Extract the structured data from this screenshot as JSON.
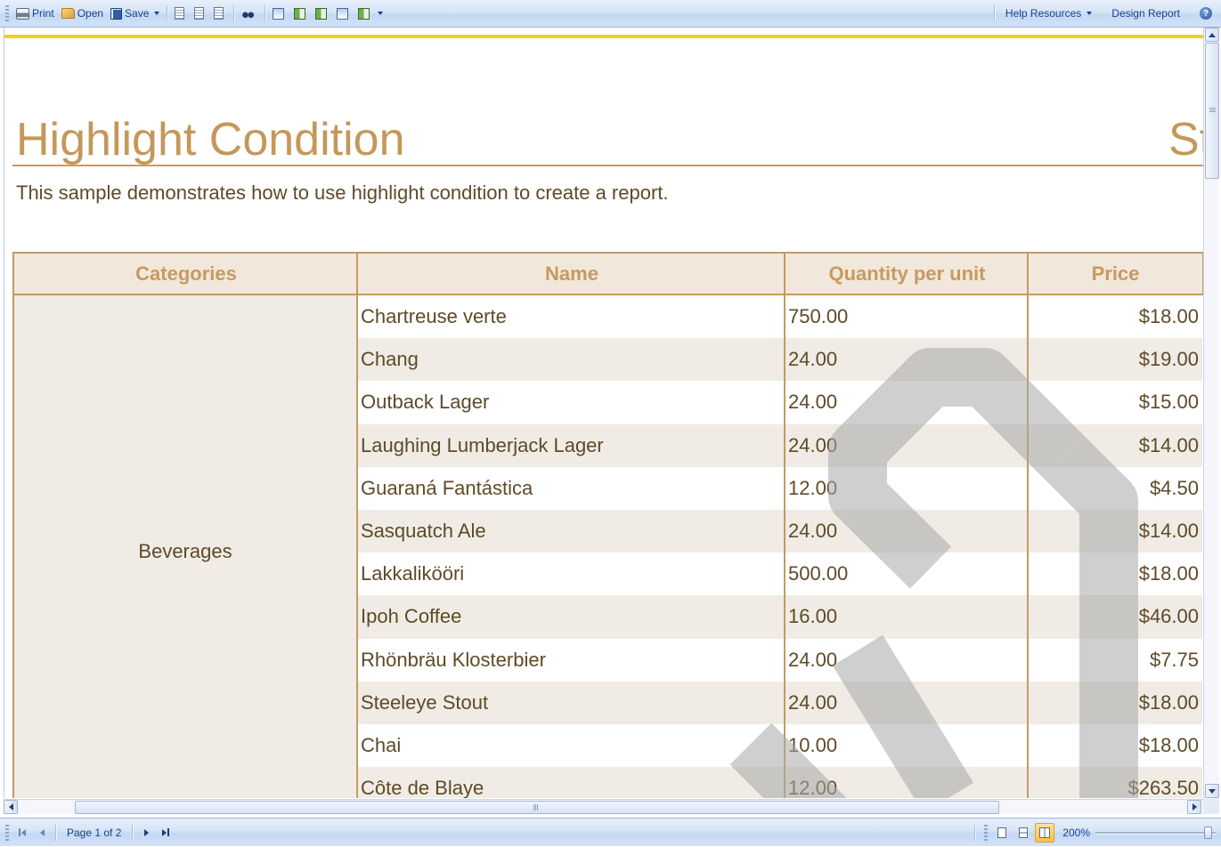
{
  "toolbar": {
    "print_label": "Print",
    "open_label": "Open",
    "save_label": "Save",
    "help_resources_label": "Help Resources",
    "design_report_label": "Design Report",
    "help_icon_glyph": "?"
  },
  "report": {
    "title": "Highlight Condition",
    "title_right_partial": "St",
    "subtitle": "This sample demonstrates how to use highlight condition to create a report.",
    "columns": [
      "Categories",
      "Name",
      "Quantity per unit",
      "Price"
    ],
    "category": "Beverages",
    "rows": [
      {
        "name": "Chartreuse verte",
        "qty": "750.00",
        "price": "$18.00"
      },
      {
        "name": "Chang",
        "qty": "24.00",
        "price": "$19.00"
      },
      {
        "name": "Outback Lager",
        "qty": "24.00",
        "price": "$15.00"
      },
      {
        "name": "Laughing Lumberjack Lager",
        "qty": "24.00",
        "price": "$14.00"
      },
      {
        "name": "Guaraná Fantástica",
        "qty": "12.00",
        "price": "$4.50"
      },
      {
        "name": "Sasquatch Ale",
        "qty": "24.00",
        "price": "$14.00"
      },
      {
        "name": "Lakkalikööri",
        "qty": "500.00",
        "price": "$18.00"
      },
      {
        "name": "Ipoh Coffee",
        "qty": "16.00",
        "price": "$46.00"
      },
      {
        "name": "Rhönbräu Klosterbier",
        "qty": "24.00",
        "price": "$7.75"
      },
      {
        "name": "Steeleye Stout",
        "qty": "24.00",
        "price": "$18.00"
      },
      {
        "name": "Chai",
        "qty": "10.00",
        "price": "$18.00"
      },
      {
        "name": "Côte de Blaye",
        "qty": "12.00",
        "price": "$263.50"
      }
    ]
  },
  "statusbar": {
    "page_label": "Page 1 of 2",
    "zoom_label": "200%",
    "zoom_fraction": 0.97
  },
  "colors": {
    "accent_gold": "#c4985a",
    "text_brown": "#5e4a28",
    "header_bg": "#f2e7db",
    "alt_row_bg": "#f0ece5",
    "yellow_rule": "#f2d01b"
  }
}
